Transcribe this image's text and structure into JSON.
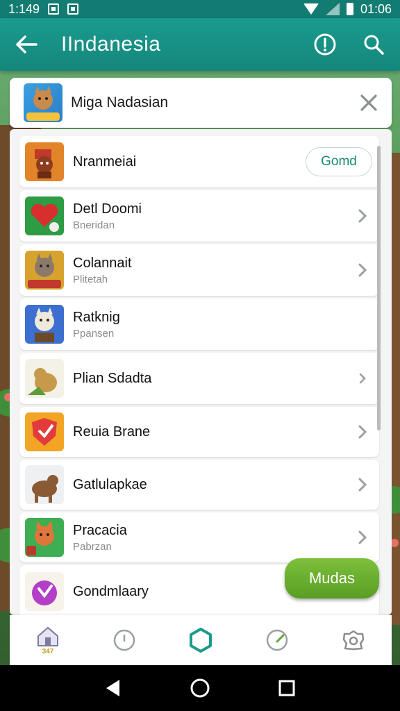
{
  "status_bar": {
    "time_left": "1:149",
    "time_right": "01:06"
  },
  "app_bar": {
    "title": "IIndanesia",
    "back_icon": "arrow-left-icon",
    "info_icon": "alert-circle-icon",
    "search_icon": "search-icon"
  },
  "search_card": {
    "label": "Miga Nadasian",
    "close_icon": "close-icon"
  },
  "list": {
    "items": [
      {
        "name": "Nranmeiai",
        "sub": "",
        "action": "Gomd",
        "icon_color": "#e2842a"
      },
      {
        "name": "Detl Doomi",
        "sub": "Bneridan",
        "icon_color": "#2e9b45"
      },
      {
        "name": "Colannait",
        "sub": "Plitetah",
        "icon_color": "#d7a32e"
      },
      {
        "name": "Ratknig",
        "sub": "Ppansen",
        "icon_color": "#3d6fd0"
      },
      {
        "name": "Plian Sdadta",
        "sub": "",
        "icon_color": "#f4f1e6"
      },
      {
        "name": "Reuia Brane",
        "sub": "",
        "icon_color": "#f2a525"
      },
      {
        "name": "Gatlulapkae",
        "sub": "",
        "icon_color": "#eef0f2"
      },
      {
        "name": "Pracacia",
        "sub": "Pabrzan",
        "icon_color": "#3fae53"
      },
      {
        "name": "Gondmlaary",
        "sub": "",
        "icon_color": "#f7f3ea"
      }
    ]
  },
  "fab": {
    "label": "Mudas"
  },
  "tabs": [
    {
      "id": "home",
      "icon": "home-icon",
      "badge": "347"
    },
    {
      "id": "mouse",
      "icon": "mouse-icon"
    },
    {
      "id": "hexagon",
      "icon": "hexagon-icon"
    },
    {
      "id": "gauge",
      "icon": "gauge-icon"
    },
    {
      "id": "settings",
      "icon": "settings-icon"
    }
  ],
  "colors": {
    "primary": "#15877c",
    "accent": "#168a73",
    "fab": "#6aac2f"
  }
}
